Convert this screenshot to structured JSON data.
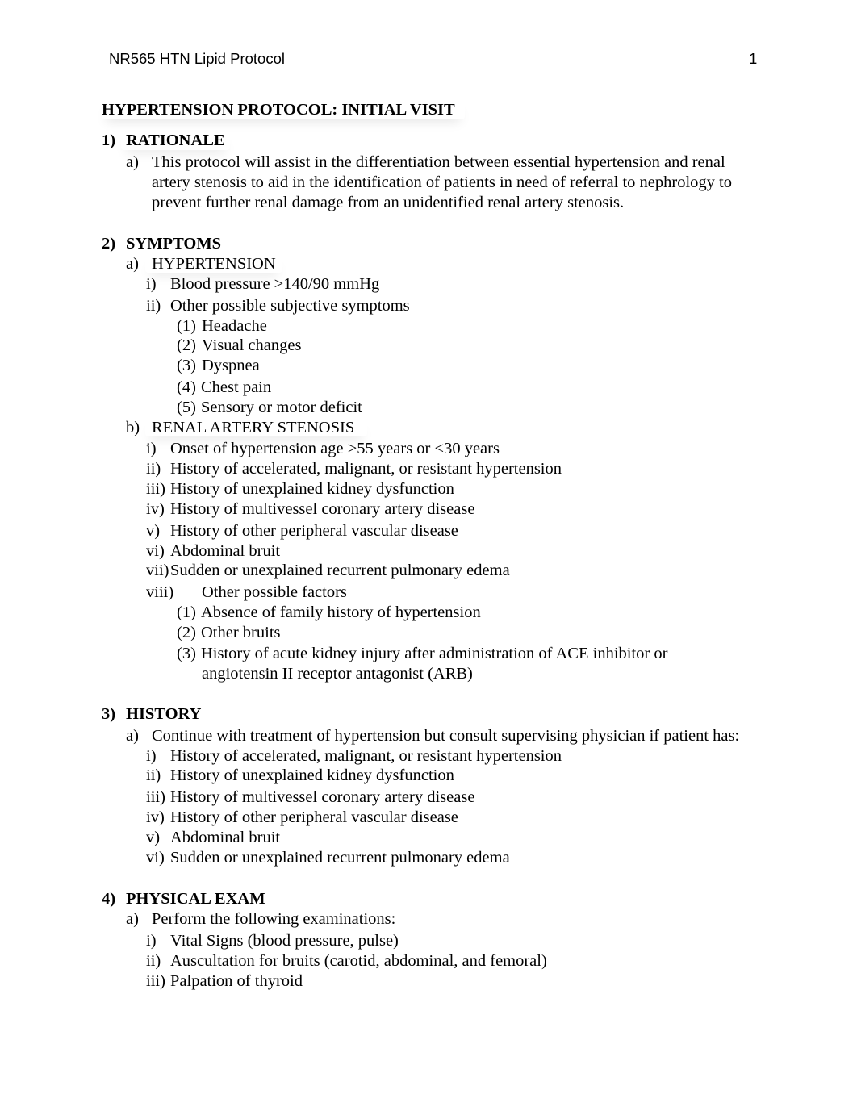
{
  "header": {
    "running_title": "NR565 HTN Lipid Protocol",
    "page_number": "1"
  },
  "title": "HYPERTENSION PROTOCOL: INITIAL VISIT",
  "sections": {
    "rationale": {
      "number": "1)",
      "heading": "RATIONALE",
      "a": {
        "label": "a)",
        "lines": [
          "This protocol will assist in the differentiation between essential hypertension and renal",
          "artery stenosis to aid in the identification of patients in need of referral to nephrology to",
          "prevent further renal damage from an unidentified renal artery stenosis."
        ]
      }
    },
    "symptoms": {
      "number": "2)",
      "heading": "SYMPTOMS",
      "a": {
        "label": "a)",
        "heading": "HYPERTENSION",
        "items": [
          {
            "label": "i)",
            "text": "Blood pressure >140/90 mmHg"
          },
          {
            "label": "ii)",
            "text": "Other possible subjective symptoms"
          }
        ],
        "subitems": [
          {
            "label": "(1)",
            "text": "Headache"
          },
          {
            "label": "(2)",
            "text": "Visual changes"
          },
          {
            "label": "(3)",
            "text": "Dyspnea"
          },
          {
            "label": "(4)",
            "text": "Chest pain"
          },
          {
            "label": "(5)",
            "text": "Sensory or motor deficit"
          }
        ]
      },
      "b": {
        "label": "b)",
        "heading": "RENAL ARTERY STENOSIS",
        "items": [
          {
            "label": "i)",
            "text": "Onset of hypertension age >55 years or <30 years"
          },
          {
            "label": "ii)",
            "text": "History of accelerated, malignant, or resistant hypertension"
          },
          {
            "label": "iii)",
            "text": "History of unexplained kidney dysfunction"
          },
          {
            "label": "iv)",
            "text": "History of multivessel coronary artery disease"
          },
          {
            "label": "v)",
            "text": "History of other peripheral vascular disease"
          },
          {
            "label": "vi)",
            "text": "Abdominal bruit"
          },
          {
            "label": "vii)",
            "text": "Sudden or unexplained recurrent pulmonary edema"
          },
          {
            "label": "viii)",
            "text": "Other possible factors"
          }
        ],
        "subitems": [
          {
            "label": "(1)",
            "text": "Absence of family history of hypertension"
          },
          {
            "label": "(2)",
            "text": "Other bruits"
          },
          {
            "label": "(3)",
            "text": "History of acute kidney injury after administration of ACE inhibitor or",
            "continuation": "angiotensin II receptor antagonist (ARB)"
          }
        ]
      }
    },
    "history": {
      "number": "3)",
      "heading": "HISTORY",
      "a": {
        "label": "a)",
        "text": "Continue with treatment of hypertension but consult supervising physician if patient has:",
        "items": [
          {
            "label": "i)",
            "text": "History of accelerated, malignant, or resistant hypertension"
          },
          {
            "label": "ii)",
            "text": "History of unexplained kidney dysfunction"
          },
          {
            "label": "iii)",
            "text": "History of multivessel coronary artery disease"
          },
          {
            "label": "iv)",
            "text": "History of other peripheral vascular disease"
          },
          {
            "label": "v)",
            "text": "Abdominal bruit"
          },
          {
            "label": "vi)",
            "text": "Sudden or unexplained recurrent pulmonary edema"
          }
        ]
      }
    },
    "physical_exam": {
      "number": "4)",
      "heading": "PHYSICAL EXAM",
      "a": {
        "label": "a)",
        "text": "Perform the following examinations:",
        "items": [
          {
            "label": "i)",
            "text": "Vital Signs (blood pressure, pulse)"
          },
          {
            "label": "ii)",
            "text": "Auscultation for bruits (carotid, abdominal, and femoral)"
          },
          {
            "label": "iii)",
            "text": "Palpation of thyroid"
          }
        ]
      }
    }
  }
}
